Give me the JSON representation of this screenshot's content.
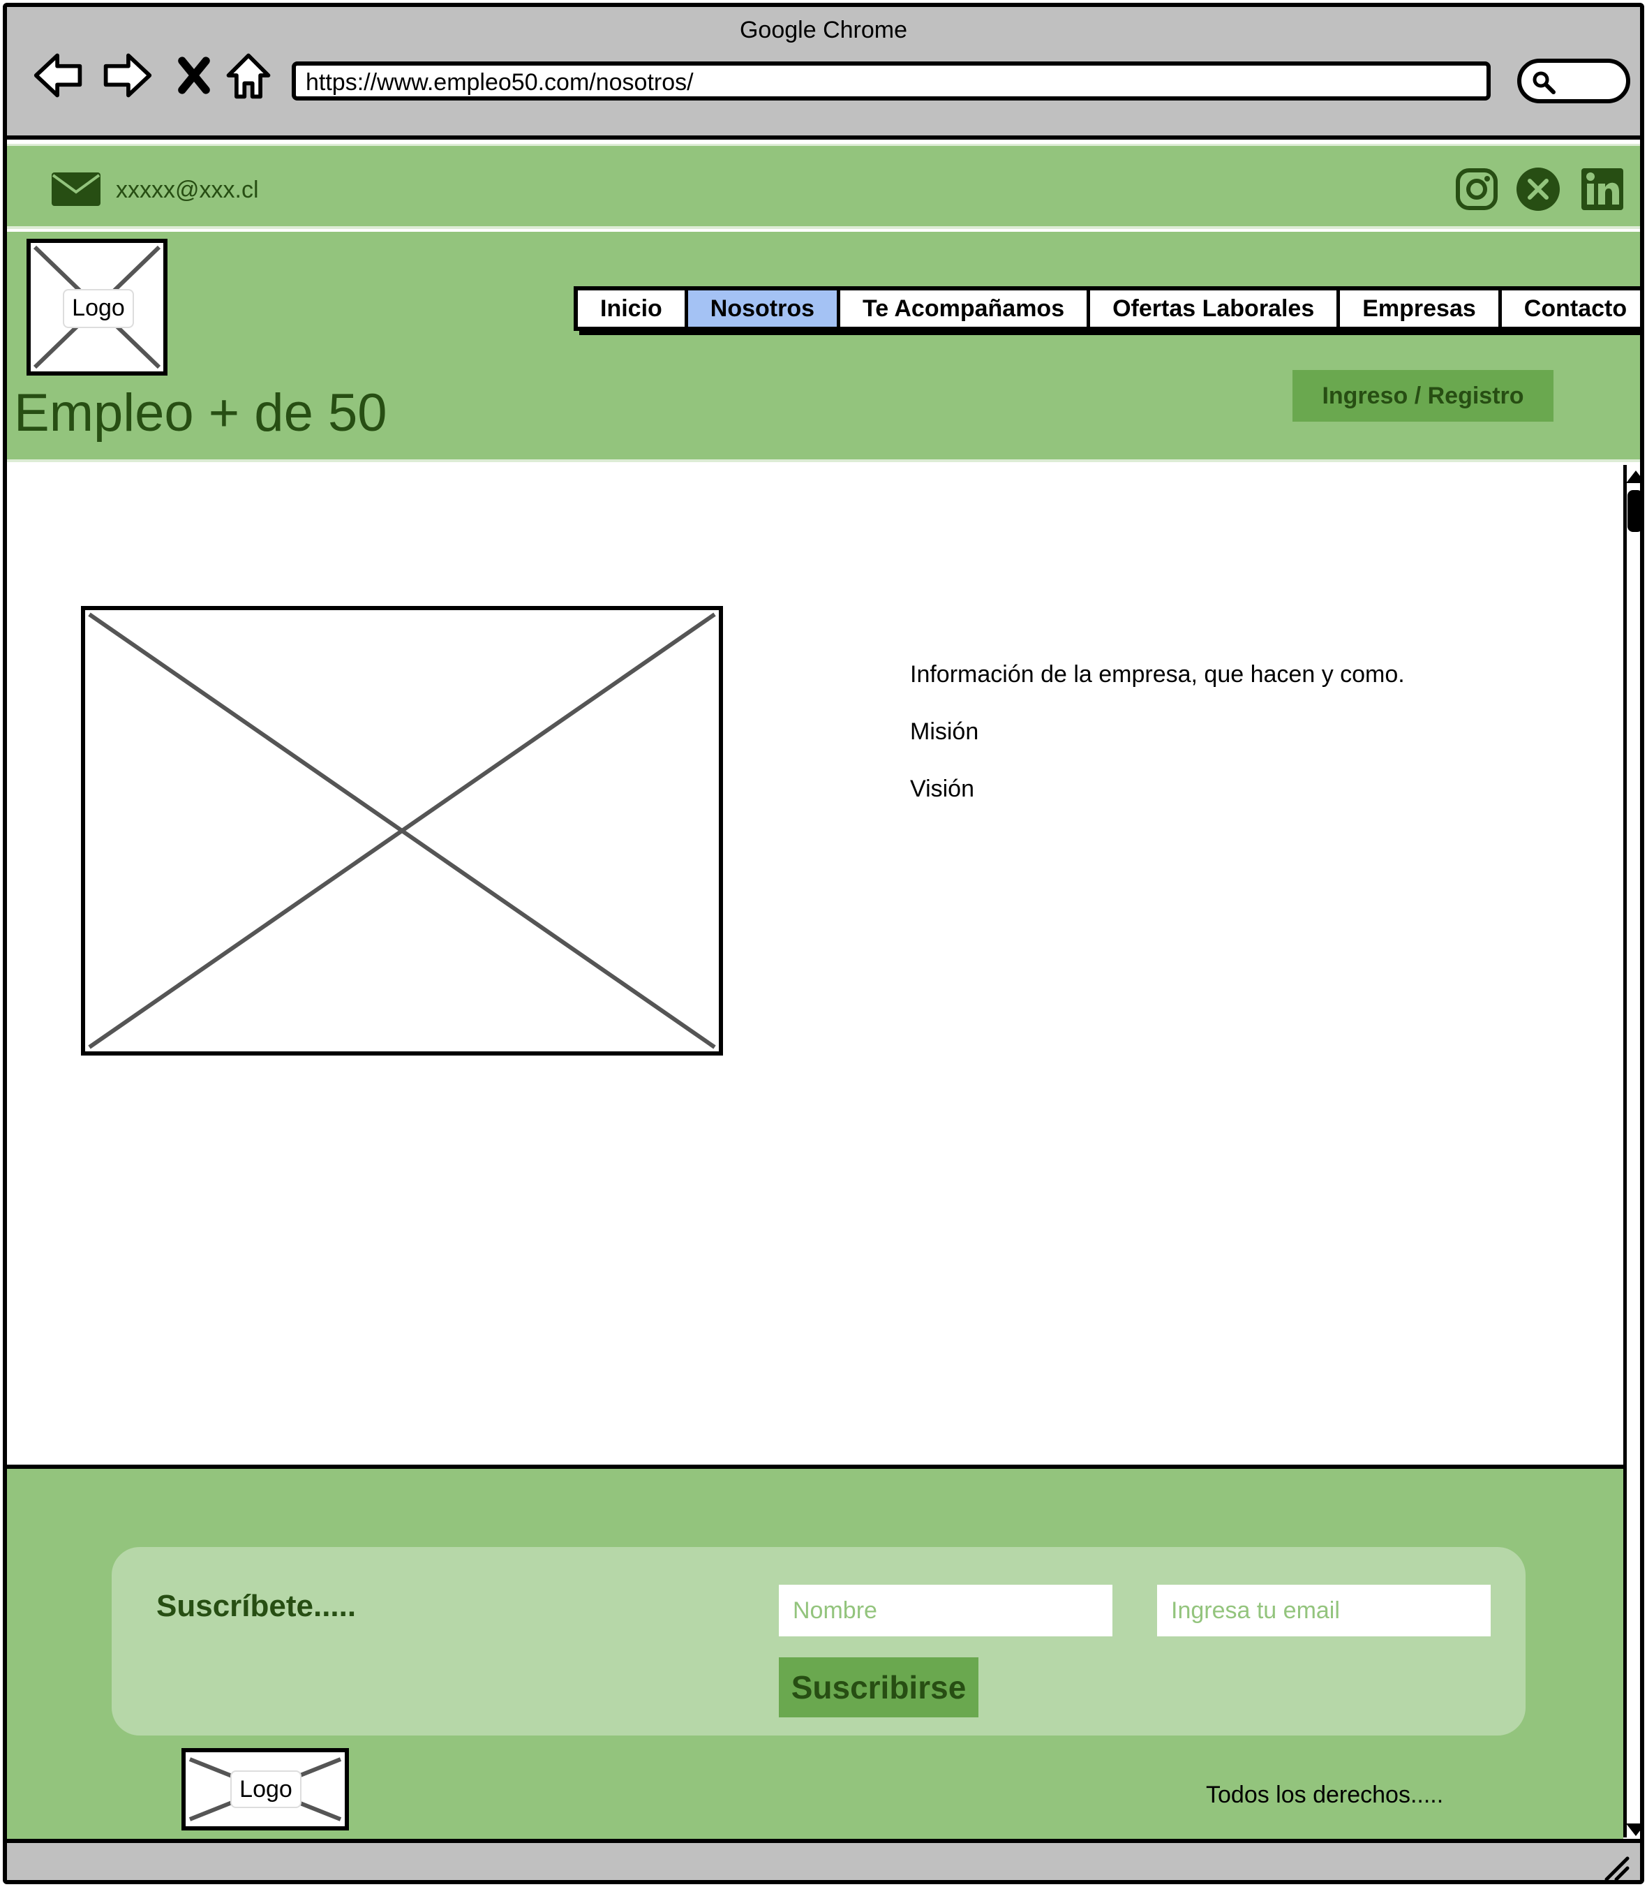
{
  "browser": {
    "title": "Google Chrome",
    "url": "https://www.empleo50.com/nosotros/"
  },
  "topbar": {
    "email": "xxxxx@xxx.cl",
    "social": [
      "instagram-icon",
      "x-icon",
      "linkedin-icon"
    ]
  },
  "header": {
    "logo_label": "Logo",
    "site_title": "Empleo + de 50",
    "nav": [
      {
        "label": "Inicio",
        "active": false
      },
      {
        "label": "Nosotros",
        "active": true
      },
      {
        "label": "Te Acompañamos",
        "active": false
      },
      {
        "label": "Ofertas Laborales",
        "active": false
      },
      {
        "label": "Empresas",
        "active": false
      },
      {
        "label": "Contacto",
        "active": false
      }
    ],
    "login_label": "Ingreso / Registro"
  },
  "content": {
    "info": "Información de la empresa, que hacen y como.",
    "mission": "Misión",
    "vision": "Visión"
  },
  "footer": {
    "subscribe_title": "Suscríbete.....",
    "name_placeholder": "Nombre",
    "email_placeholder": "Ingresa tu email",
    "subscribe_button": "Suscribirse",
    "logo_label": "Logo",
    "rights": "Todos los derechos....."
  },
  "colors": {
    "green": "#93c47d",
    "dark_green": "#274e13",
    "button_green": "#6aa84f",
    "light_green": "#b6d7a8",
    "active_nav": "#a4c2f4",
    "chrome_gray": "#c0c0c0"
  }
}
